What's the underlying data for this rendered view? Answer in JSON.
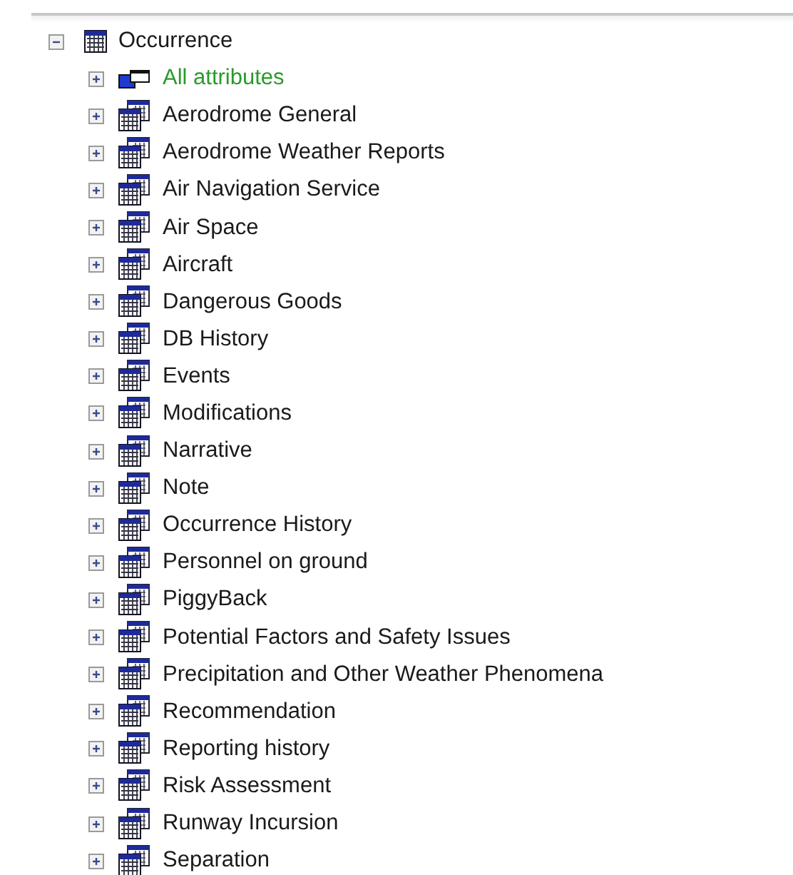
{
  "tree": {
    "label": "Occurrence",
    "expanded": true,
    "children": [
      {
        "label": "All attributes",
        "kind": "attributes",
        "expanded": false
      },
      {
        "label": "Aerodrome General",
        "kind": "table",
        "expanded": false
      },
      {
        "label": "Aerodrome Weather Reports",
        "kind": "table",
        "expanded": false
      },
      {
        "label": "Air Navigation Service",
        "kind": "table",
        "expanded": false
      },
      {
        "label": "Air Space",
        "kind": "table",
        "expanded": false
      },
      {
        "label": "Aircraft",
        "kind": "table",
        "expanded": false
      },
      {
        "label": "Dangerous Goods",
        "kind": "table",
        "expanded": false
      },
      {
        "label": "DB History",
        "kind": "table",
        "expanded": false
      },
      {
        "label": "Events",
        "kind": "table",
        "expanded": false
      },
      {
        "label": "Modifications",
        "kind": "table",
        "expanded": false
      },
      {
        "label": "Narrative",
        "kind": "table",
        "expanded": false
      },
      {
        "label": "Note",
        "kind": "table",
        "expanded": false
      },
      {
        "label": "Occurrence History",
        "kind": "table",
        "expanded": false
      },
      {
        "label": "Personnel on ground",
        "kind": "table",
        "expanded": false
      },
      {
        "label": "PiggyBack",
        "kind": "table",
        "expanded": false
      },
      {
        "label": "Potential Factors and Safety Issues",
        "kind": "table",
        "expanded": false
      },
      {
        "label": "Precipitation and Other Weather Phenomena",
        "kind": "table",
        "expanded": false
      },
      {
        "label": "Recommendation",
        "kind": "table",
        "expanded": false
      },
      {
        "label": "Reporting history",
        "kind": "table",
        "expanded": false
      },
      {
        "label": "Risk Assessment",
        "kind": "table",
        "expanded": false
      },
      {
        "label": "Runway Incursion",
        "kind": "table",
        "expanded": false
      },
      {
        "label": "Separation",
        "kind": "table",
        "expanded": false
      }
    ]
  }
}
